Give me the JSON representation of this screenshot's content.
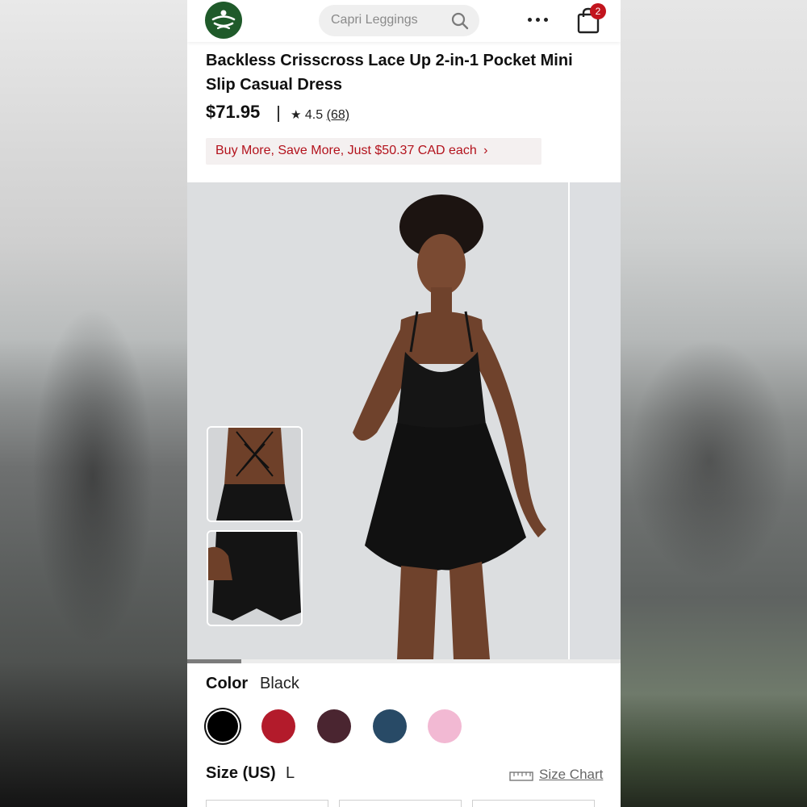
{
  "header": {
    "search_placeholder": "Capri Leggings",
    "cart_count": "2"
  },
  "product": {
    "title": "Backless Crisscross Lace Up 2-in-1 Pocket Mini Slip Casual Dress",
    "price": "$71.95",
    "rating_star": "★",
    "rating": "4.5",
    "review_count": "(68)",
    "promo": "Buy More, Save More, Just $50.37 CAD each",
    "promo_chevron": "›"
  },
  "gallery": {
    "progress_fraction": 0.125
  },
  "color": {
    "label": "Color",
    "value": "Black",
    "swatches": [
      "#000000",
      "#b31b2b",
      "#4a2530",
      "#284a66",
      "#f2b9d3"
    ]
  },
  "size": {
    "label": "Size (US)",
    "value": "L",
    "chart_link": "Size Chart"
  }
}
